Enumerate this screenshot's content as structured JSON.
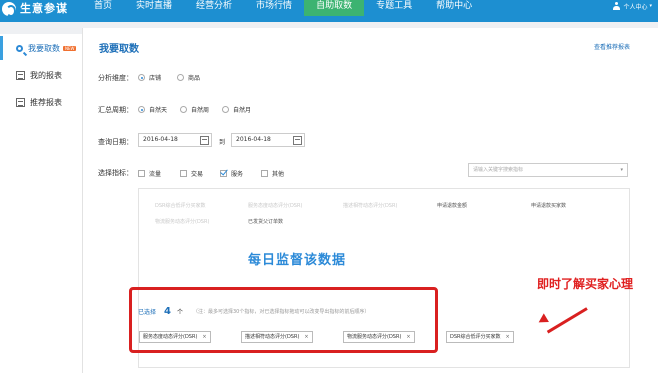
{
  "header": {
    "logo_text": "生意参谋",
    "nav": [
      {
        "label": "首页"
      },
      {
        "label": "实时直播"
      },
      {
        "label": "经营分析"
      },
      {
        "label": "市场行情"
      },
      {
        "label": "自助取数",
        "active": true
      },
      {
        "label": "专题工具"
      },
      {
        "label": "帮助中心"
      }
    ],
    "user_label": "个人中心",
    "caret": "▾"
  },
  "sidebar": {
    "items": [
      {
        "label": "我要取数",
        "icon": "search-icon",
        "badge": "NEW",
        "active": true
      },
      {
        "label": "我的报表",
        "icon": "report-icon"
      },
      {
        "label": "推荐报表",
        "icon": "report-icon"
      }
    ]
  },
  "main": {
    "title": "我要取数",
    "recommend_link": "查看推荐报表",
    "dimension": {
      "label": "分析维度：",
      "options": [
        {
          "label": "店铺",
          "checked": true
        },
        {
          "label": "商品",
          "checked": false
        }
      ]
    },
    "period": {
      "label": "汇总周期：",
      "options": [
        {
          "label": "自然天",
          "checked": true
        },
        {
          "label": "自然周",
          "checked": false
        },
        {
          "label": "自然月",
          "checked": false
        }
      ]
    },
    "query_date": {
      "label": "查询日期：",
      "start": "2016-04-18",
      "to": "到",
      "end": "2016-04-18"
    },
    "indicators": {
      "label": "选择指标：",
      "types": [
        {
          "label": "流量",
          "checked": false
        },
        {
          "label": "交易",
          "checked": false
        },
        {
          "label": "服务",
          "checked": true
        },
        {
          "label": "其他",
          "checked": false
        }
      ],
      "search_placeholder": "请输入关键字搜索指标",
      "search_caret": "▾",
      "list": [
        {
          "label": "DSR综合低评分买家数",
          "enabled": false
        },
        {
          "label": "服务态度动态评分(DSR)",
          "enabled": false
        },
        {
          "label": "描述相符动态评分(DSR)",
          "enabled": false
        },
        {
          "label": "申请退款金额",
          "enabled": true
        },
        {
          "label": "申请退款买家数",
          "enabled": true
        },
        {
          "label": "物流服务动态评分(DSR)",
          "enabled": false
        },
        {
          "label": "已发货父订单数",
          "enabled": true
        }
      ]
    },
    "overlay_blue": "每日监督该数据",
    "overlay_red": "即时了解买家心理",
    "selected": {
      "label": "已选择",
      "count": "4",
      "unit": "个",
      "note": "（注：最多可选择30个指标，对已选择指标拖动可以改变导出指标的前后顺序）",
      "chips": [
        {
          "label": "服务态度动态评分(DSR)",
          "remove": "×"
        },
        {
          "label": "描述相符动态评分(DSR)",
          "remove": "×"
        },
        {
          "label": "物流服务动态评分(DSR)",
          "remove": "×"
        },
        {
          "label": "DSR综合低评分买家数",
          "remove": "×"
        }
      ]
    }
  },
  "colors": {
    "nav_bg": "#1d8fd1",
    "nav_active": "#3cb371",
    "accent_blue": "#1d6fb8",
    "annotation_red": "#d92020"
  }
}
